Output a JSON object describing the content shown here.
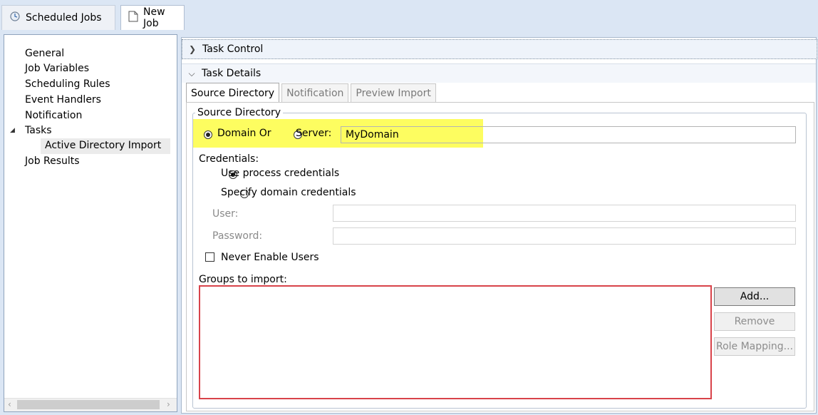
{
  "doc_tabs": [
    {
      "label": "Scheduled Jobs",
      "icon": "scheduled-jobs-icon"
    },
    {
      "label": "New Job",
      "icon": "new-document-icon"
    }
  ],
  "nav": {
    "items": [
      "General",
      "Job Variables",
      "Scheduling Rules",
      "Event Handlers",
      "Notification",
      "Tasks",
      "Active Directory Import",
      "Job Results"
    ],
    "expand_glyph": "◢"
  },
  "sections": {
    "task_control": "Task Control",
    "task_details": "Task Details"
  },
  "inner_tabs": [
    "Source Directory",
    "Notification",
    "Preview Import"
  ],
  "source_directory": {
    "legend": "Source Directory",
    "domain_label": "Domain Or",
    "server_label": "Server:",
    "server_value": "MyDomain",
    "selected": "Domain Or"
  },
  "credentials": {
    "label": "Credentials:",
    "option_process": "Use process credentials",
    "option_domain": "Specify domain credentials",
    "user_label": "User:",
    "user_value": "",
    "password_label": "Password:",
    "password_value": "",
    "never_enable": "Never Enable Users",
    "never_enable_checked": false
  },
  "groups": {
    "label": "Groups to import:",
    "items": []
  },
  "buttons": {
    "add": "Add...",
    "remove": "Remove",
    "role_mapping": "Role Mapping..."
  },
  "colors": {
    "highlight": "#fdfd60",
    "groups_border": "#d8434a",
    "background": "#dbe6f4"
  }
}
